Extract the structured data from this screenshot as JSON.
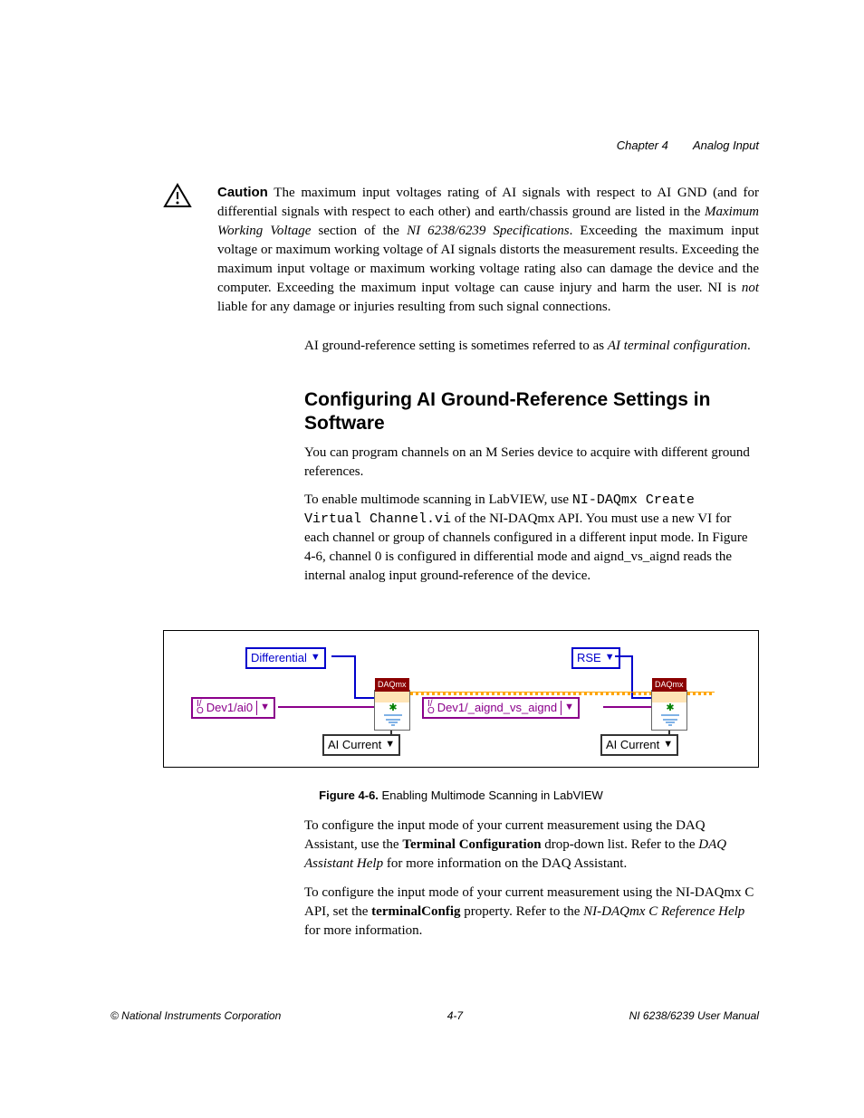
{
  "header": {
    "chapter": "Chapter 4",
    "title": "Analog Input"
  },
  "caution": {
    "label": "Caution",
    "text_parts": {
      "p1": "The maximum input voltages rating of AI signals with respect to AI GND (and for differential signals with respect to each other) and earth/chassis ground are listed in the ",
      "p2_italic": "Maximum Working Voltage",
      "p3": " section of the ",
      "p4_italic": "NI 6238/6239 Specifications",
      "p5": ". Exceeding the maximum input voltage or maximum working voltage of AI signals distorts the measurement results. Exceeding the maximum input voltage or maximum working voltage rating also can damage the device and the computer. Exceeding the maximum input voltage can cause injury and harm the user. NI is ",
      "p6_italic": "not",
      "p7": " liable for any damage or injuries resulting from such signal connections."
    }
  },
  "para1": {
    "t1": "AI ground-reference setting is sometimes referred to as ",
    "t2_italic": "AI terminal configuration",
    "t3": "."
  },
  "heading": "Configuring AI Ground-Reference Settings in Software",
  "para2": "You can program channels on an M Series device to acquire with different ground references.",
  "para3": {
    "t1": "To enable multimode scanning in LabVIEW, use ",
    "t2_mono": "NI-DAQmx Create Virtual Channel.vi",
    "t3": " of the NI-DAQmx API. You must use a new VI for each channel or group of channels configured in a different input mode. In Figure 4-6, channel 0 is configured in differential mode and aignd_vs_aignd reads the internal analog input ground-reference of the device."
  },
  "figure": {
    "differential": "Differential",
    "rse": "RSE",
    "dev_ai0": "Dev1/ai0",
    "dev_aignd": "Dev1/_aignd_vs_aignd",
    "ai_current1": "AI Current",
    "ai_current2": "AI Current",
    "daqmx": "DAQmx",
    "caption_label": "Figure 4-6.",
    "caption_text": "Enabling Multimode Scanning in LabVIEW"
  },
  "para4": {
    "t1": "To configure the input mode of your current measurement using the DAQ Assistant, use the ",
    "t2_bold": "Terminal Configuration",
    "t3": " drop-down list. Refer to the ",
    "t4_italic": "DAQ Assistant Help",
    "t5": " for more information on the DAQ Assistant."
  },
  "para5": {
    "t1": "To configure the input mode of your current measurement using the NI-DAQmx C API, set the ",
    "t2_bold": "terminalConfig",
    "t3": " property. Refer to the ",
    "t4_italic": "NI-DAQmx C Reference Help",
    "t5": " for more information."
  },
  "footer": {
    "left": "© National Instruments Corporation",
    "center": "4-7",
    "right": "NI 6238/6239 User Manual"
  }
}
